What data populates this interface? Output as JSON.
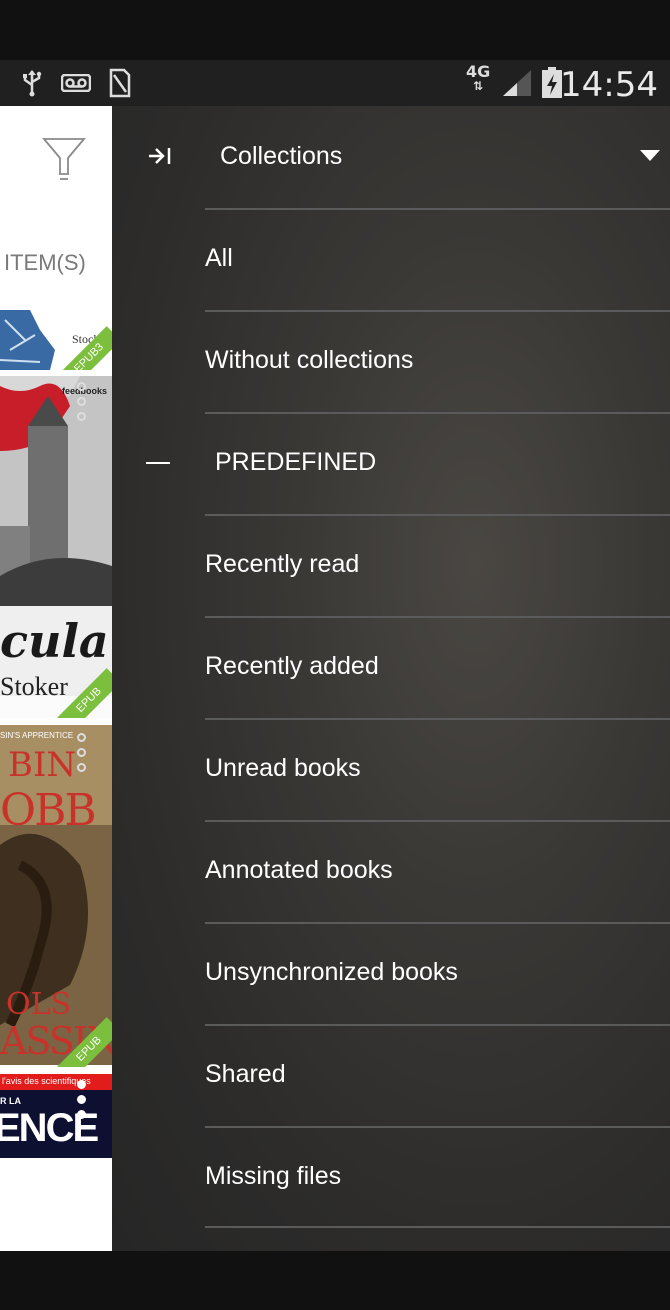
{
  "status_bar": {
    "time": "14:54",
    "network": "4G",
    "icons": [
      "usb-icon",
      "voicemail-icon",
      "sim-icon",
      "signal-icon",
      "battery-charging-icon"
    ]
  },
  "library": {
    "items_label": "ITEM(S)",
    "filter_icon": "filter-icon",
    "badge": "EPUB",
    "covers": [
      {
        "top_text": "Stock",
        "badge": "EPUB3"
      },
      {
        "top_text": "feedbooks",
        "title": "cula",
        "author": "Stoker",
        "badge": "EPUB"
      },
      {
        "top_text": "SIN'S APPRENTICE",
        "title_a": "BIN",
        "title_b": "OBB",
        "subtitle_a": "OLS",
        "subtitle_b": "ASSIN",
        "badge": "EPUB"
      },
      {
        "top_text": "l'avis des scientifiques",
        "small": "R LA",
        "title": "ENCE"
      }
    ]
  },
  "drawer": {
    "header_title": "Collections",
    "items": [
      {
        "label": "All"
      },
      {
        "label": "Without collections"
      },
      {
        "label": "PREDEFINED",
        "section": true
      },
      {
        "label": "Recently read"
      },
      {
        "label": "Recently added"
      },
      {
        "label": "Unread books"
      },
      {
        "label": "Annotated books"
      },
      {
        "label": "Unsynchronized books"
      },
      {
        "label": "Shared"
      },
      {
        "label": "Missing files"
      }
    ]
  },
  "colors": {
    "accent": "#ee3f6a",
    "epub_badge": "#7bbf3c",
    "drawer_bg": "#2d2c2b"
  }
}
